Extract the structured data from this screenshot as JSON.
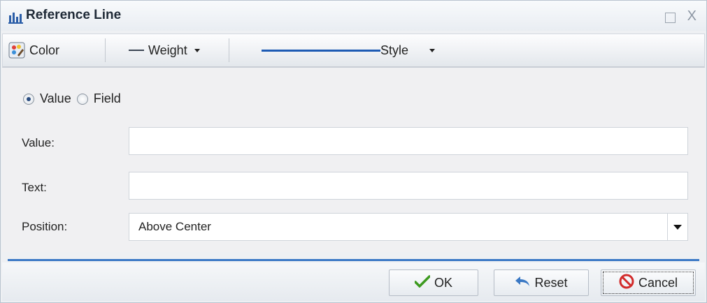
{
  "window": {
    "title": "Reference Line",
    "icons": {
      "app": "bar-chart-icon",
      "maximize": "maximize-icon",
      "close": "close-icon"
    },
    "close_glyph": "X"
  },
  "toolbar": {
    "color_label": "Color",
    "weight_label": "Weight",
    "style_label": "Style",
    "icons": {
      "color": "palette-icon",
      "dropdown": "caret-down-icon"
    },
    "accent": "#1e5bb4"
  },
  "form": {
    "mode_options": [
      {
        "label": "Value",
        "checked": true
      },
      {
        "label": "Field",
        "checked": false
      }
    ],
    "value_label": "Value:",
    "value_value": "",
    "text_label": "Text:",
    "text_value": "",
    "position_label": "Position:",
    "position_selected": "Above Center"
  },
  "buttons": {
    "ok_label": "OK",
    "reset_label": "Reset",
    "cancel_label": "Cancel",
    "icons": {
      "ok": "check-icon",
      "reset": "undo-arrow-icon",
      "cancel": "cancel-icon"
    }
  }
}
